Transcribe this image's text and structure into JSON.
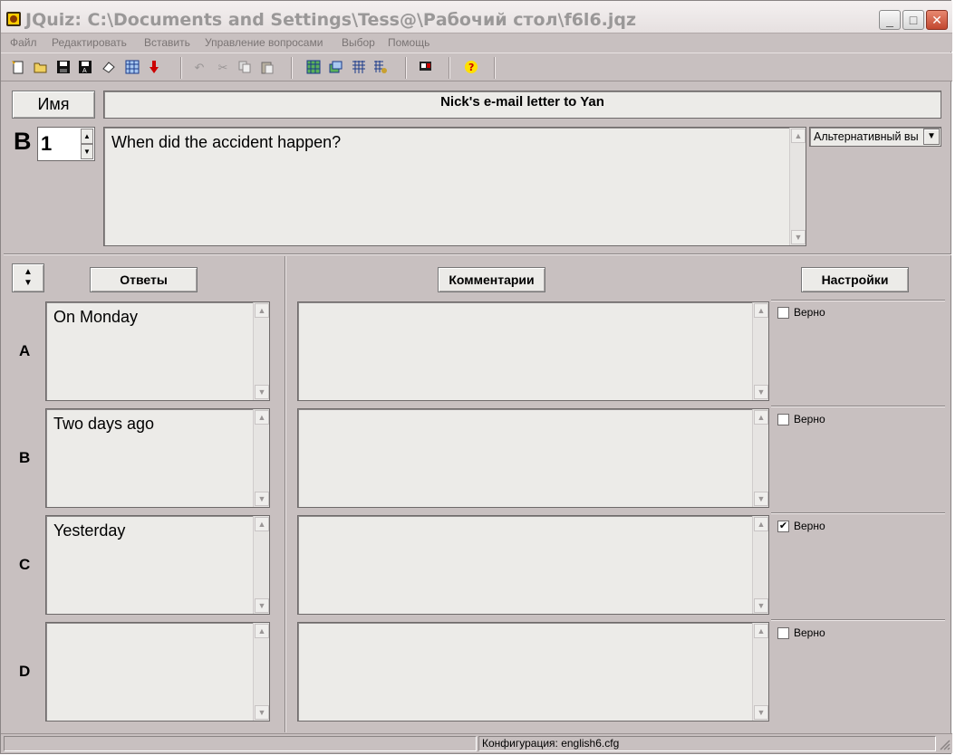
{
  "window": {
    "title": "JQuiz: C:\\Documents and Settings\\Tess@\\Рабочий стол\\f6l6.jqz",
    "min_glyph": "_",
    "max_glyph": "□",
    "close_glyph": "✕"
  },
  "menu": [
    "Файл",
    "Редактировать",
    "Вставить",
    "Управление вопросами",
    "Выбор",
    "Помощь"
  ],
  "toolbar": {
    "icons": [
      "new-file-icon",
      "open-folder-icon",
      "save-icon",
      "save-as-icon",
      "eraser-icon",
      "grid-icon",
      "arrow-down-icon",
      "undo-icon",
      "cut-icon",
      "copy-icon",
      "paste-icon",
      "web-page-icon",
      "export-icon",
      "grid-export-icon",
      "web-export-icon",
      "monitor-icon",
      "help-icon"
    ]
  },
  "header": {
    "name_button": "Имя",
    "title_value": "Nick's e-mail letter to Yan"
  },
  "question": {
    "label": "В",
    "number": "1",
    "text": "When did the accident happen?",
    "type_selected": "Альтернативный вы"
  },
  "columns": {
    "answers": "Ответы",
    "comments": "Комментарии",
    "settings": "Настройки"
  },
  "answers": [
    {
      "letter": "A",
      "text": "On Monday",
      "comment": "",
      "correct_label": "Верно",
      "correct": false
    },
    {
      "letter": "B",
      "text": "Two days ago",
      "comment": "",
      "correct_label": "Верно",
      "correct": false
    },
    {
      "letter": "C",
      "text": "Yesterday",
      "comment": "",
      "correct_label": "Верно",
      "correct": true
    },
    {
      "letter": "D",
      "text": "",
      "comment": "",
      "correct_label": "Верно",
      "correct": false
    }
  ],
  "status": {
    "config": "Конфигурация: english6.cfg"
  }
}
